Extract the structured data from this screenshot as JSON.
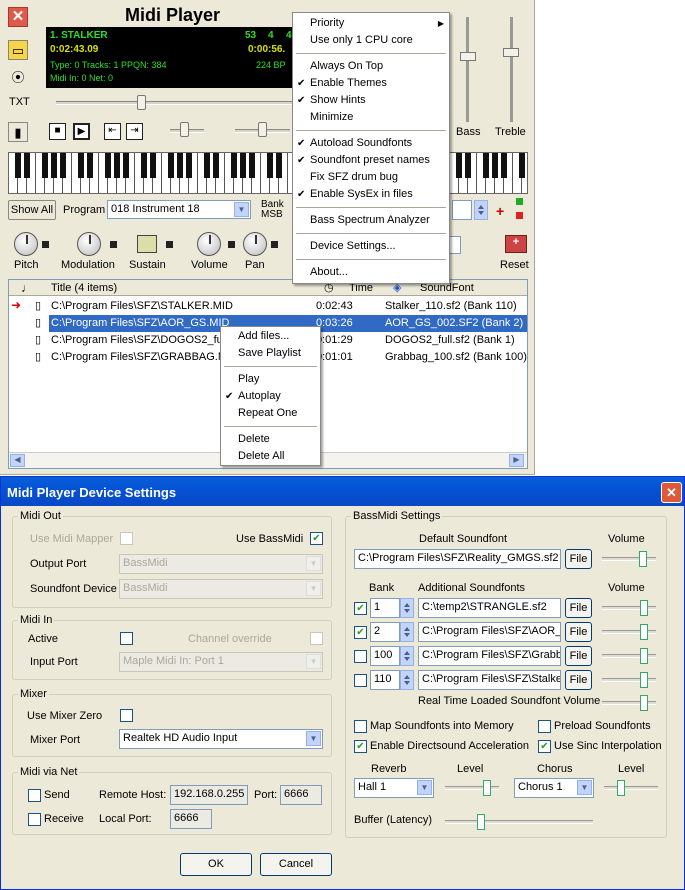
{
  "player": {
    "title": "Midi Player",
    "lcd": {
      "song": "1. STALKER",
      "n1": "53",
      "n2": "4",
      "n3": "4",
      "time": "0:02:43.09",
      "time2": "0:00:56.",
      "info": "Type: 0  Tracks: 1  PPQN: 384",
      "bpm": "224 BP",
      "midi": "Midi In: 0  Net: 0"
    },
    "side_txt": "TXT",
    "bass_label": "Bass",
    "treble_label": "Treble",
    "show_all": "Show All",
    "program_label": "Program",
    "program_value": "018 Instrument 18",
    "bank_label": "Bank",
    "msb_label": "MSB",
    "knobs": [
      "Pitch",
      "Modulation",
      "Sustain",
      "Volume",
      "Pan"
    ],
    "reset": "Reset",
    "list": {
      "title_header": "Title  (4 items)",
      "time_header": "Time",
      "sf_header": "SoundFont",
      "rows": [
        {
          "path": "C:\\Program Files\\SFZ\\STALKER.MID",
          "time": "0:02:43",
          "sf": "Stalker_110.sf2 (Bank 110)"
        },
        {
          "path": "C:\\Program Files\\SFZ\\AOR_GS.MID",
          "time": "0:03:26",
          "sf": "AOR_GS_002.SF2 (Bank 2)"
        },
        {
          "path": "C:\\Program Files\\SFZ\\DOGOS2_ful",
          "time": "0:01:29",
          "sf": "DOGOS2_full.sf2 (Bank 1)"
        },
        {
          "path": "C:\\Program Files\\SFZ\\GRABBAG.M",
          "time": "0:01:01",
          "sf": "Grabbag_100.sf2 (Bank 100)"
        }
      ]
    }
  },
  "main_menu": [
    {
      "label": "Priority",
      "check": false,
      "sub": true
    },
    {
      "label": "Use only 1 CPU core",
      "check": false
    },
    {
      "label": "Always On Top",
      "check": false
    },
    {
      "label": "Enable Themes",
      "check": true
    },
    {
      "label": "Show Hints",
      "check": true
    },
    {
      "label": "Minimize",
      "check": false
    },
    {
      "label": "Autoload Soundfonts",
      "check": true
    },
    {
      "label": "Soundfont preset names",
      "check": true
    },
    {
      "label": "Fix SFZ drum bug",
      "check": false
    },
    {
      "label": "Enable SysEx in files",
      "check": true
    },
    {
      "label": "Bass Spectrum Analyzer",
      "check": false
    },
    {
      "label": "Device Settings...",
      "check": false
    },
    {
      "label": "About...",
      "check": false
    }
  ],
  "list_menu": [
    {
      "label": "Add files...",
      "check": false
    },
    {
      "label": "Save Playlist",
      "check": false
    },
    {
      "label": "Play",
      "check": false
    },
    {
      "label": "Autoplay",
      "check": true
    },
    {
      "label": "Repeat One",
      "check": false
    },
    {
      "label": "Delete",
      "check": false
    },
    {
      "label": "Delete All",
      "check": false
    }
  ],
  "dialog": {
    "title": "Midi Player Device Settings",
    "midi_out": {
      "label": "Midi Out",
      "use_mapper": "Use Midi Mapper",
      "use_bassmidi": "Use BassMidi",
      "output_port": "Output Port",
      "output_value": "BassMidi",
      "sf_device": "Soundfont Device",
      "sf_value": "BassMidi"
    },
    "midi_in": {
      "label": "Midi In",
      "active": "Active",
      "channel_override": "Channel override",
      "input_port": "Input Port",
      "input_value": "Maple Midi In: Port 1"
    },
    "mixer": {
      "label": "Mixer",
      "use_zero": "Use Mixer Zero",
      "mixer_port": "Mixer Port",
      "port_value": "Realtek HD Audio Input"
    },
    "net": {
      "label": "Midi via Net",
      "send": "Send",
      "receive": "Receive",
      "remote_host": "Remote Host:",
      "host_value": "192.168.0.255",
      "port": "Port:",
      "port_value": "6666",
      "local_port": "Local Port:",
      "local_value": "6666"
    },
    "bassmidi": {
      "label": "BassMidi Settings",
      "default_sf": "Default Soundfont",
      "volume": "Volume",
      "default_path": "C:\\Program Files\\SFZ\\Reality_GMGS.sf2",
      "file": "File",
      "bank": "Bank",
      "additional": "Additional Soundfonts",
      "rows": [
        {
          "checked": true,
          "bank": "1",
          "path": "C:\\temp2\\STRANGLE.sf2"
        },
        {
          "checked": true,
          "bank": "2",
          "path": "C:\\Program Files\\SFZ\\AOR_"
        },
        {
          "checked": false,
          "bank": "100",
          "path": "C:\\Program Files\\SFZ\\Grabb"
        },
        {
          "checked": false,
          "bank": "110",
          "path": "C:\\Program Files\\SFZ\\Stalke"
        }
      ],
      "rt_volume": "Real Time Loaded Soundfont Volume",
      "map_memory": "Map Soundfonts into Memory",
      "preload": "Preload Soundfonts",
      "directsound": "Enable Directsound Acceleration",
      "sinc": "Use Sinc Interpolation",
      "reverb": "Reverb",
      "level": "Level",
      "chorus": "Chorus",
      "reverb_value": "Hall 1",
      "chorus_value": "Chorus 1",
      "buffer": "Buffer (Latency)"
    },
    "ok": "OK",
    "cancel": "Cancel"
  }
}
